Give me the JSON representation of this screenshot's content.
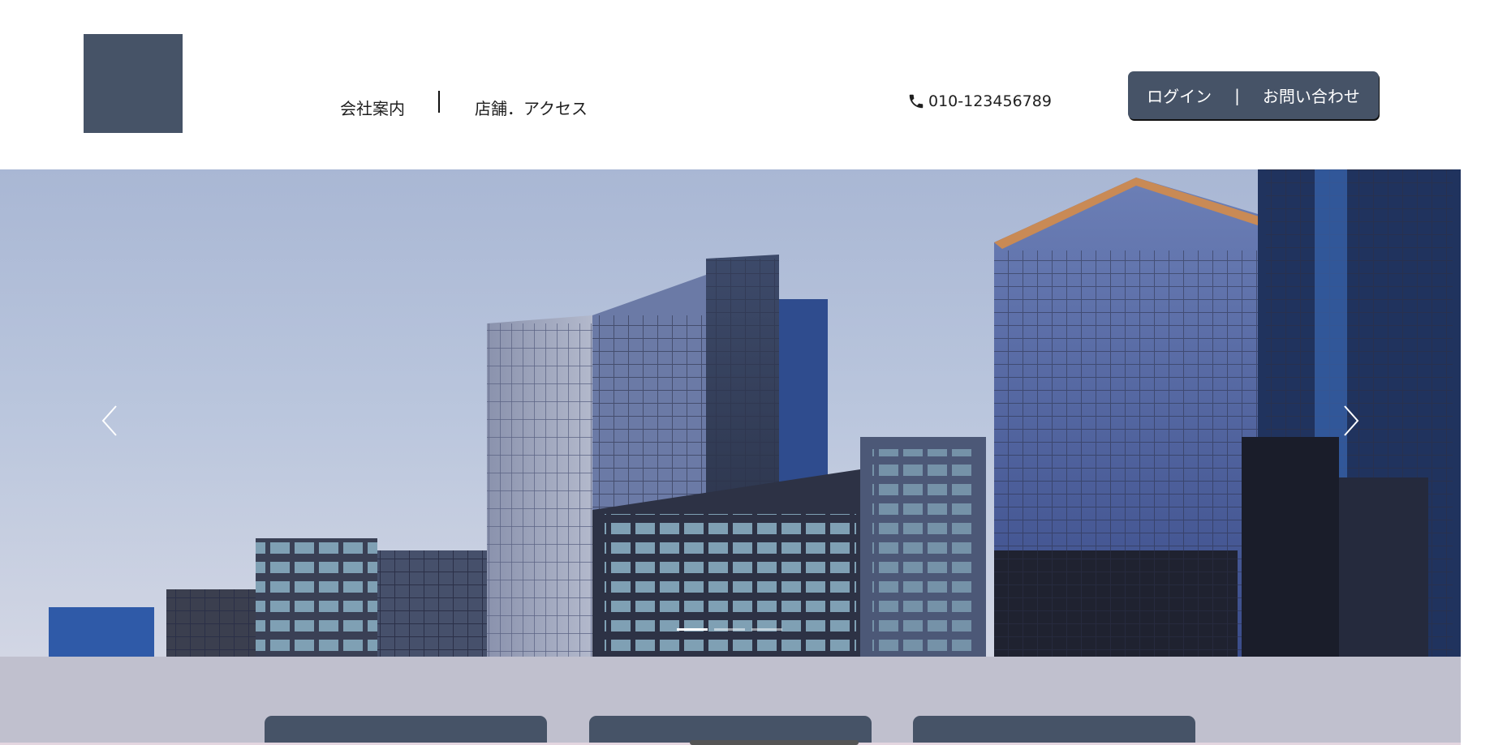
{
  "header": {
    "logo": "company-logo",
    "nav": {
      "company_label": "会社案内",
      "store_label": "店舗．アクセス"
    },
    "phone": {
      "icon": "phone-icon",
      "number": "010-123456789"
    },
    "auth": {
      "login_label": "ログイン",
      "separator": "|",
      "contact_label": "お問い合わせ"
    }
  },
  "hero": {
    "image": "city-buildings-photo",
    "prev_icon": "chevron-left-icon",
    "next_icon": "chevron-right-icon",
    "slide_count": 3,
    "active_slide": 1
  },
  "features": {
    "card_count": 3
  },
  "colors": {
    "brand": "#465367",
    "lower_band": "#c0c0ce",
    "sky": "#b8c4dc"
  }
}
